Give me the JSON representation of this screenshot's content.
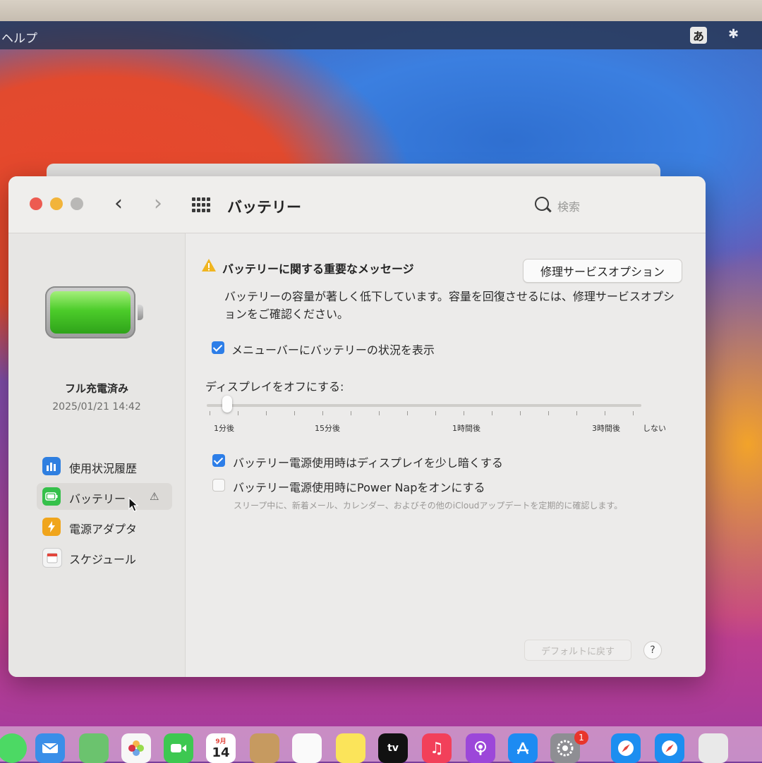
{
  "menubar": {
    "help_label": "ヘルプ",
    "ime_label": "あ",
    "bluetooth_glyph": "✱"
  },
  "window": {
    "title": "バッテリー",
    "back_glyph": "‹",
    "forward_glyph": "›",
    "search_placeholder": "検索"
  },
  "sidebar": {
    "status_title": "フル充電済み",
    "status_time": "2025/01/21 14:42",
    "items": [
      {
        "label": "使用状況履歴",
        "icon": "bar-chart-icon",
        "color": "#2f7fe0"
      },
      {
        "label": "バッテリー",
        "icon": "battery-icon",
        "color": "#35c04a",
        "selected": true,
        "warning": "⚠"
      },
      {
        "label": "電源アダプタ",
        "icon": "lightning-icon",
        "color": "#f0a51c"
      },
      {
        "label": "スケジュール",
        "icon": "calendar-icon",
        "color": "#f4f4f4"
      }
    ]
  },
  "main": {
    "message_title": "バッテリーに関する重要なメッセージ",
    "repair_button": "修理サービスオプション",
    "message_body": "バッテリーの容量が著しく低下しています。容量を回復させるには、修理サービスオプションをご確認ください。",
    "show_in_menubar": {
      "label": "メニューバーにバッテリーの状況を表示",
      "checked": true
    },
    "display_off_label": "ディスプレイをオフにする:",
    "slider_labels": [
      "1分後",
      "15分後",
      "1時間後",
      "3時間後",
      "しない"
    ],
    "dim_display": {
      "label": "バッテリー電源使用時はディスプレイを少し暗くする",
      "checked": true
    },
    "power_nap": {
      "label": "バッテリー電源使用時にPower Napをオンにする",
      "checked": false
    },
    "power_nap_desc": "スリープ中に、新着メール、カレンダー、およびその他のiCloudアップデートを定期的に確認します。",
    "default_button": "デフォルトに戻す",
    "help_button": "?"
  },
  "dock": {
    "calendar_month": "9月",
    "calendar_day": "14",
    "tv_label": "tv",
    "badge_count": "1"
  },
  "colors": {
    "accent": "#2d7ee8",
    "close": "#ed5b51",
    "minimize": "#f2b43a"
  }
}
